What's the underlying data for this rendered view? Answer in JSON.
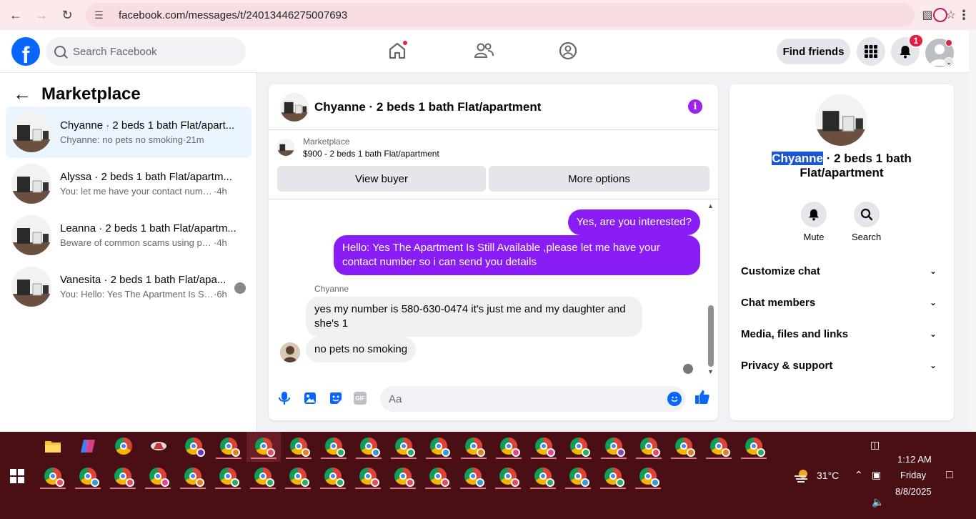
{
  "browser": {
    "url": "facebook.com/messages/t/24013446275007693"
  },
  "header": {
    "logo_letter": "f",
    "search_placeholder": "Search Facebook",
    "find_friends_label": "Find friends",
    "notification_count": "1"
  },
  "left": {
    "title": "Marketplace",
    "threads": [
      {
        "name": "Chyanne · 2 beds 1 bath Flat/apart...",
        "snippet": "Chyanne: no pets no smoking",
        "time": "·21m",
        "active": true
      },
      {
        "name": "Alyssa · 2 beds 1 bath Flat/apartm...",
        "snippet": "You: let me have your contact number...",
        "time": "·4h"
      },
      {
        "name": "Leanna · 2 beds 1 bath Flat/apartm...",
        "snippet": "Beware of common scams using pay...",
        "time": "·4h"
      },
      {
        "name": "Vanesita · 2 beds 1 bath Flat/apa...",
        "snippet": "You: Hello: Yes The Apartment Is Sti...",
        "time": "·6h"
      }
    ]
  },
  "chat": {
    "title": "Chyanne · 2 beds 1 bath Flat/apartment",
    "marketplace_label": "Marketplace",
    "listing": "$900 - 2 beds 1 bath Flat/apartment",
    "view_buyer_label": "View buyer",
    "more_options_label": "More options",
    "messages": {
      "out1": "Yes, are you interested?",
      "out2": "Hello: Yes The Apartment Is Still Available ,please let me have your contact number so i can send you details",
      "sender": "Chyanne",
      "in1": "yes my number is 580-630-0474 it's just me and my daughter and she's 1",
      "in2": "no pets no smoking"
    },
    "composer_placeholder": "Aa",
    "gif_label": "GIF"
  },
  "right": {
    "title_name": "Chyanne",
    "title_rest": " · 2 beds 1 bath Flat/apartment",
    "mute_label": "Mute",
    "search_label": "Search",
    "sections": [
      "Customize chat",
      "Chat members",
      "Media, files and links",
      "Privacy & support"
    ]
  },
  "taskbar": {
    "temperature": "31°C",
    "time": "1:12 AM",
    "day": "Friday",
    "date": "8/8/2025"
  },
  "colors": {
    "accent": "#8a1cf5",
    "fb_blue": "#0866ff",
    "taskbar_bg": "#4a0f14"
  }
}
